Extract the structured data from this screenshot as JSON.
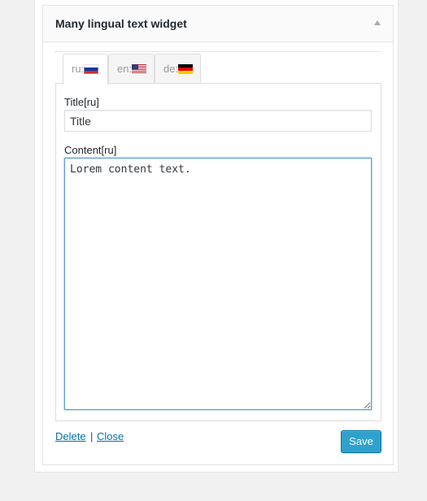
{
  "widget": {
    "title": "Many lingual text widget"
  },
  "tabs": [
    {
      "label": "ru:",
      "flag": "russia-flag-icon",
      "active": true
    },
    {
      "label": "en:",
      "flag": "usa-flag-icon",
      "active": false
    },
    {
      "label": "de:",
      "flag": "germany-flag-icon",
      "active": false
    }
  ],
  "fields": {
    "title_label": "Title[ru]",
    "title_value": "Title",
    "content_label": "Content[ru]",
    "content_value": "Lorem content text."
  },
  "footer": {
    "delete_label": "Delete",
    "separator": "|",
    "close_label": "Close",
    "save_label": "Save"
  },
  "colors": {
    "accent": "#2ea2cc",
    "link": "#0073aa",
    "focus_border": "#5b9dd9"
  }
}
